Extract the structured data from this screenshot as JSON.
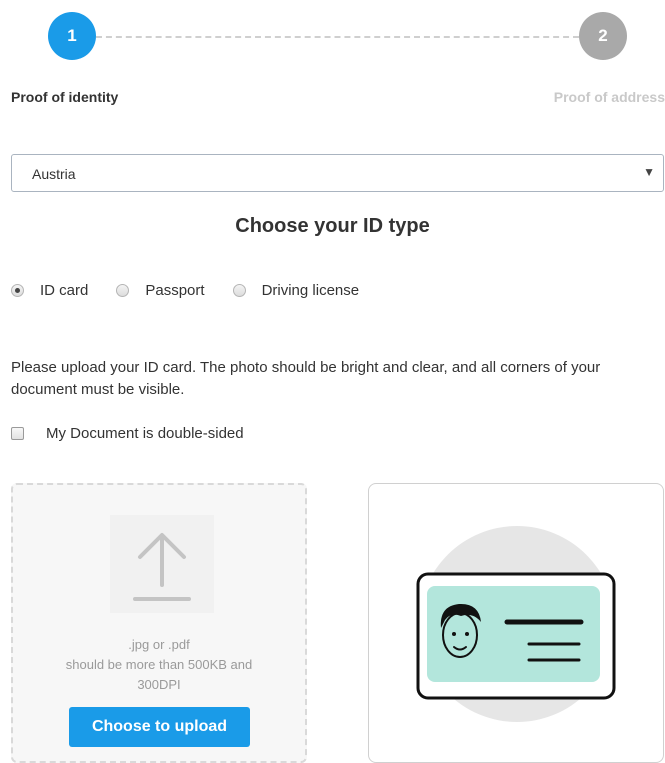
{
  "stepper": {
    "steps": [
      {
        "number": "1",
        "label": "Proof of identity",
        "state": "active",
        "color": "#1a9be8"
      },
      {
        "number": "2",
        "label": "Proof of address",
        "state": "inactive",
        "color": "#a9a9a9"
      }
    ]
  },
  "country_select": {
    "value": "Austria",
    "caret": "▼"
  },
  "id_type": {
    "title": "Choose your ID type",
    "options": [
      {
        "label": "ID card",
        "selected": true
      },
      {
        "label": "Passport",
        "selected": false
      },
      {
        "label": "Driving license",
        "selected": false
      }
    ]
  },
  "instructions": "Please upload your ID card. The photo should be bright and clear, and all corners of your document must be visible.",
  "double_sided": {
    "label": "My Document is double-sided",
    "checked": false
  },
  "upload": {
    "formats": ".jpg or .pdf",
    "requirement_line1": "should be more than 500KB and",
    "requirement_line2": "300DPI",
    "button_label": "Choose to upload",
    "icon": "upload-arrow-icon"
  },
  "example": {
    "icon": "id-card-illustration",
    "card_color": "#b3e6dc"
  }
}
